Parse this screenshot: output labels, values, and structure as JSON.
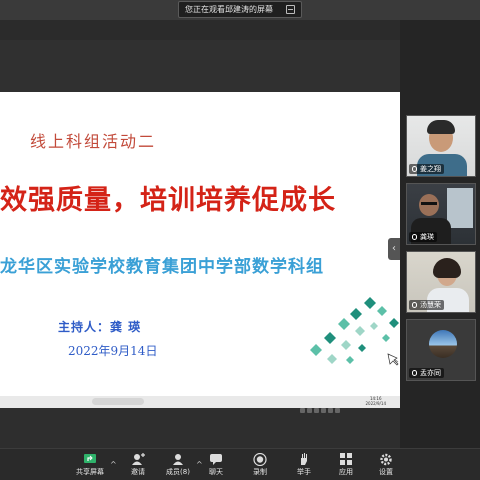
{
  "banner": {
    "text": "您正在观看邱建涛的屏幕"
  },
  "slide": {
    "title": "线上科组活动二",
    "main_heading": "效强质量，培训培养促成长",
    "subheading": "龙华区实验学校教育集团中学部数学科组",
    "host": "主持人：龚 瑛",
    "date": "2022年9月14日",
    "taskbar_time": "14:16",
    "taskbar_date": "2022/9/14"
  },
  "participants": [
    {
      "name": "姜之翔"
    },
    {
      "name": "龚瑛"
    },
    {
      "name": "汤慧荣"
    },
    {
      "name": "孟亦同"
    }
  ],
  "toolbar": {
    "items": [
      {
        "label": "共享屏幕",
        "icon": "share-screen-icon"
      },
      {
        "label": "邀请",
        "icon": "invite-icon"
      },
      {
        "label": "成员(8)",
        "icon": "members-icon"
      },
      {
        "label": "聊天",
        "icon": "chat-icon"
      },
      {
        "label": "录制",
        "icon": "record-icon"
      },
      {
        "label": "举手",
        "icon": "raise-hand-icon"
      },
      {
        "label": "应用",
        "icon": "apps-icon"
      },
      {
        "label": "设置",
        "icon": "settings-icon"
      }
    ]
  },
  "colors": {
    "title_red": "#d42317",
    "subtitle_blue": "#3aa0d6",
    "host_blue": "#2f5cc7",
    "share_green": "#2fb36b"
  }
}
